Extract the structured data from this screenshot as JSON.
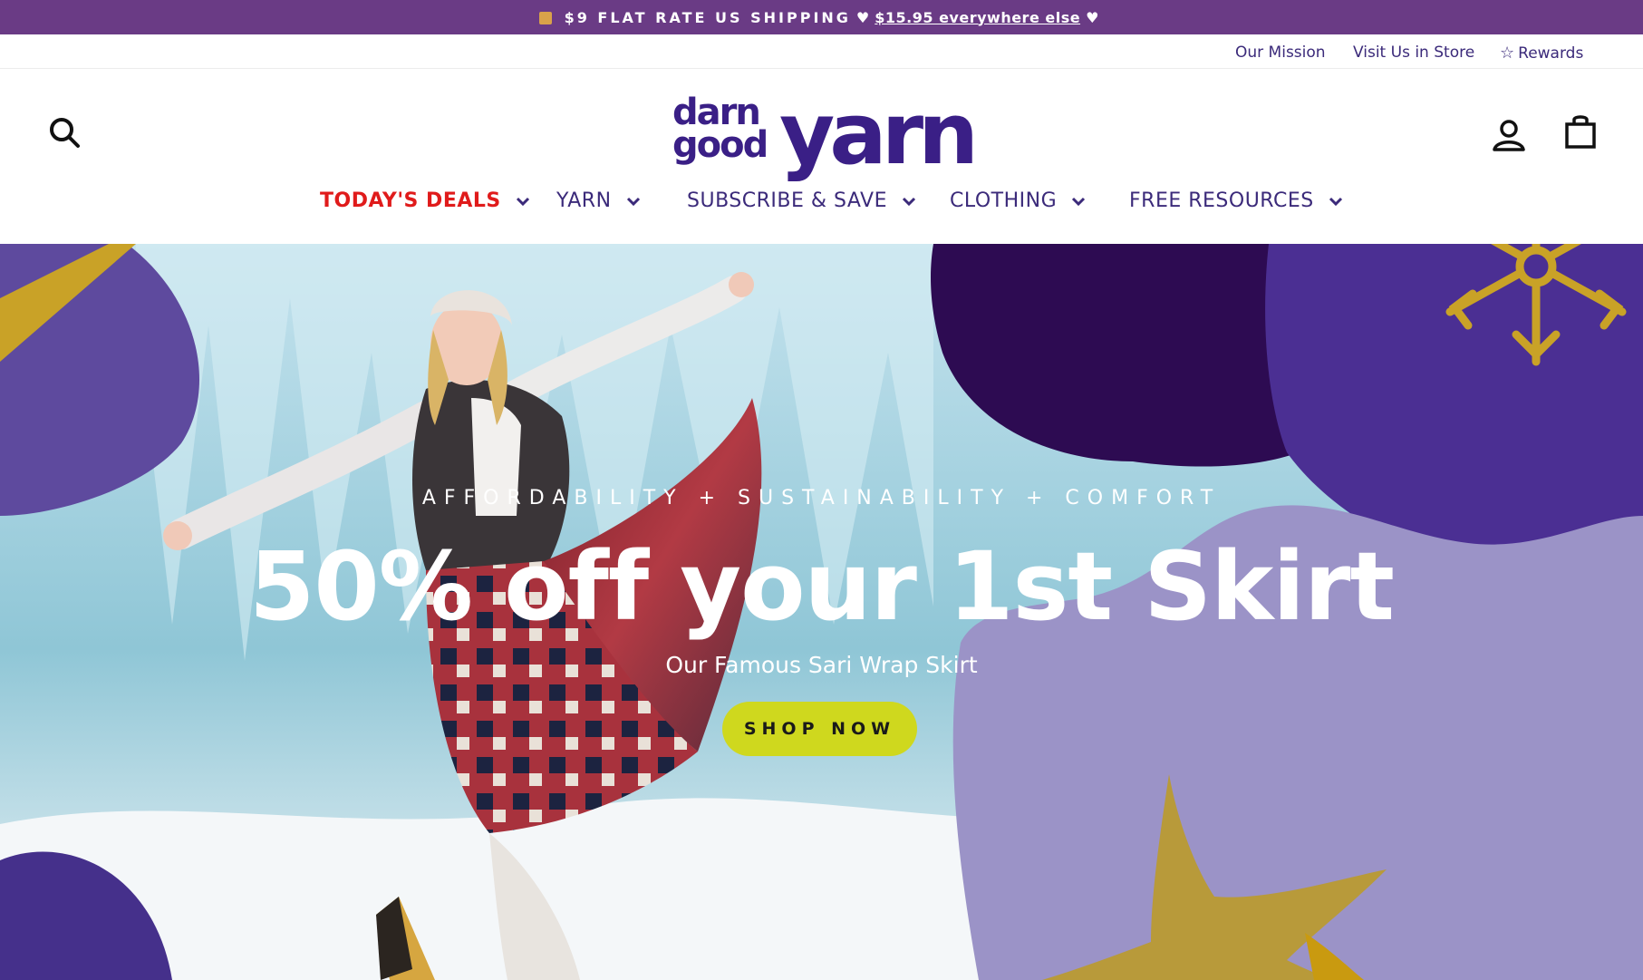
{
  "announcement": {
    "text": "$9 FLAT RATE US SHIPPING",
    "link_text": "$15.95 everywhere else",
    "heart": "♥"
  },
  "utility_links": {
    "mission": "Our Mission",
    "store": "Visit Us in Store",
    "rewards": "Rewards"
  },
  "logo": {
    "line1": "darn",
    "line2": "good",
    "big": "yarn"
  },
  "nav": {
    "items": [
      {
        "label": "TODAY'S DEALS"
      },
      {
        "label": "YARN"
      },
      {
        "label": "SUBSCRIBE & SAVE"
      },
      {
        "label": "CLOTHING"
      },
      {
        "label": "FREE RESOURCES"
      }
    ]
  },
  "hero": {
    "tagline": "AFFORDABILITY + SUSTAINABILITY + COMFORT",
    "headline": "50% off your 1st Skirt",
    "subline": "Our Famous Sari Wrap Skirt",
    "cta": "SHOP NOW"
  },
  "icons": [
    "package-icon",
    "heart-icon",
    "star-outline-icon",
    "search-icon",
    "account-icon",
    "cart-bag-icon",
    "chevron-down-icon",
    "snowflake-icon",
    "gold-star-icon"
  ],
  "colors": {
    "announcement_bg": "#6a3b85",
    "brand_purple": "#3a1f86",
    "deal_red": "#e01b1b",
    "cta_lime": "#cfd81e",
    "blob_dark": "#2d0b52",
    "blob_lavender": "#9b93c7",
    "gold": "#c9a227"
  }
}
